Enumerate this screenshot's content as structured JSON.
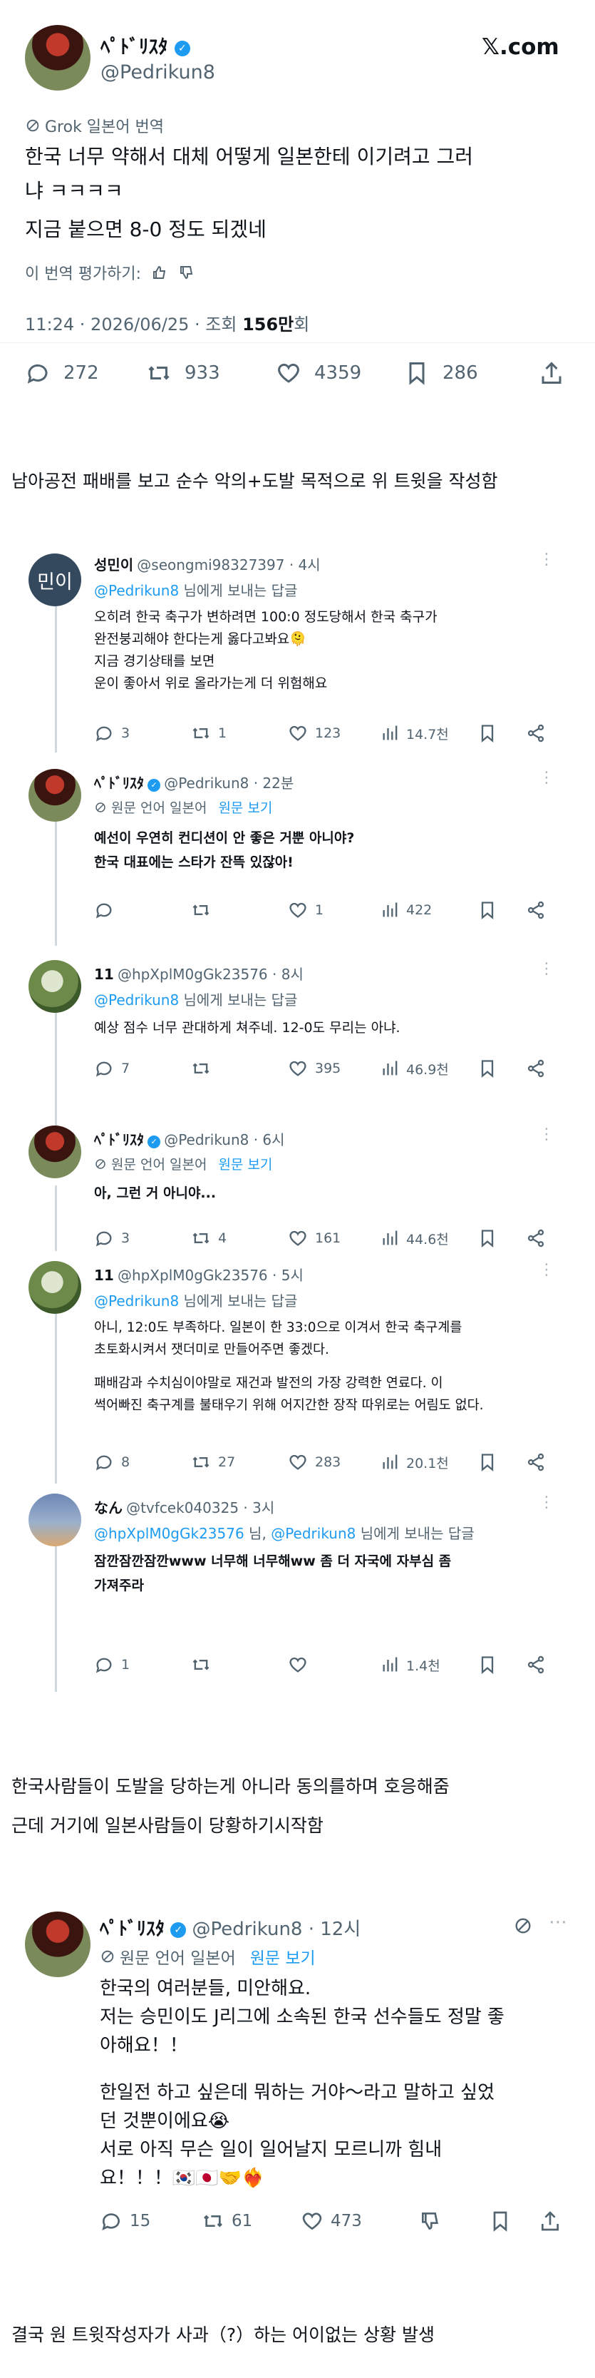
{
  "main": {
    "display_name": "ﾍﾟﾄﾞﾘｽﾀ",
    "handle": "@Pedrikun8",
    "logo_text": "𝕏.com",
    "grok_label": "Grok 일본어 번역",
    "text_line1": "한국 너무 약해서 대체 어떻게 일본한테 이기려고 그러",
    "text_line2": "냐 ㅋㅋㅋㅋ",
    "text_line3": "지금 붙으면 8-0 정도 되겠네",
    "rate_label": "이 번역 평가하기:",
    "meta_time": "11:24 · 2026/06/25 · 조회 ",
    "meta_views": "156만",
    "meta_unit": "회",
    "replies": "272",
    "retweets": "933",
    "likes": "4359",
    "bookmarks": "286"
  },
  "caption1": "남아공전 패배를 보고 순수 악의+도발 목적으로 위 트윗을 작성함",
  "r1": {
    "name": "성민이",
    "handle": "@seongmi98327397 · 4시",
    "avatar_text": "민이",
    "to_user": "@Pedrikun8",
    "to_suffix": " 님에게 보내는 답글",
    "line1": "오히려 한국 축구가 변하려면 100:0 정도당해서 한국 축구가",
    "line2": "완전붕괴해야 한다는게 옳다고봐요🫠",
    "line3": "지금 경기상태를 보면",
    "line4": "운이 좋아서 위로 올라가는게 더 위험해요",
    "replies": "3",
    "retweets": "1",
    "likes": "123",
    "views": "14.7천"
  },
  "r2": {
    "name": "ﾍﾟﾄﾞﾘｽﾀ",
    "handle": "@Pedrikun8 · 22분",
    "orig_lang": "원문 언어 일본어",
    "view_orig": "원문 보기",
    "line1": "예선이 우연히 컨디션이 안 좋은 거뿐 아니야?",
    "line2": "한국 대표에는 스타가 잔뜩 있잖아!",
    "replies": "",
    "retweets": "",
    "likes": "1",
    "views": "422"
  },
  "r3": {
    "name": "11",
    "handle": "@hpXplM0gGk23576 · 8시",
    "to_user": "@Pedrikun8",
    "to_suffix": " 님에게 보내는 답글",
    "line1": "예상 점수 너무 관대하게 쳐주네. 12-0도 무리는 아냐.",
    "replies": "7",
    "retweets": "",
    "likes": "395",
    "views": "46.9천"
  },
  "r4": {
    "name": "ﾍﾟﾄﾞﾘｽﾀ",
    "handle": "@Pedrikun8 · 6시",
    "orig_lang": "원문 언어 일본어",
    "view_orig": "원문 보기",
    "line1": "아, 그런 거 아니야...",
    "replies": "3",
    "retweets": "4",
    "likes": "161",
    "views": "44.6천"
  },
  "r5": {
    "name": "11",
    "handle": "@hpXplM0gGk23576 · 5시",
    "to_user": "@Pedrikun8",
    "to_suffix": " 님에게 보내는 답글",
    "line1": "아니, 12:0도 부족하다. 일본이 한 33:0으로 이겨서 한국 축구계를",
    "line2": "초토화시켜서 잿더미로 만들어주면 좋겠다.",
    "line3": "패배감과 수치심이야말로 재건과 발전의 가장 강력한 연료다. 이",
    "line4": "썩어빠진 축구계를 불태우기 위해 어지간한 장작 따위로는 어림도 없다.",
    "replies": "8",
    "retweets": "27",
    "likes": "283",
    "views": "20.1천"
  },
  "r6": {
    "name": "なん",
    "handle": "@tvfcek040325 · 3시",
    "to_user": "@hpXplM0gGk23576",
    "to_mid": " 님, ",
    "to_user2": "@Pedrikun8",
    "to_suffix": " 님에게 보내는 답글",
    "line1": "잠깐잠깐잠깐www 너무해 너무해ww 좀 더 자국에 자부심 좀",
    "line2": "가져주라",
    "replies": "1",
    "retweets": "",
    "likes": "",
    "views": "1.4천"
  },
  "caption2": "한국사람들이 도발을 당하는게 아니라 동의를하며 호응해줌",
  "caption3": "근데 거기에 일본사람들이 당황하기시작함",
  "apology": {
    "name": "ﾍﾟﾄﾞﾘｽﾀ",
    "handle": "@Pedrikun8 · 12시",
    "orig_lang": "원문 언어 일본어",
    "view_orig": "원문 보기",
    "line1": "한국의 여러분들, 미안해요.",
    "line2": "저는 승민이도 J리그에 소속된 한국 선수들도 정말 좋",
    "line3": "아해요！！",
    "line4": "한일전 하고 싶은데 뭐하는 거야～라고 말하고 싶었",
    "line5": "던 것뿐이에요😭",
    "line6": "서로 아직 무슨 일이 일어날지 모르니까 힘내",
    "line7": "요！！！🇰🇷🇯🇵🤝❤️‍🔥",
    "replies": "15",
    "retweets": "61",
    "likes": "473"
  },
  "caption4": "결국 원 트윗작성자가 사과（?）하는 어이없는 상황 발생"
}
